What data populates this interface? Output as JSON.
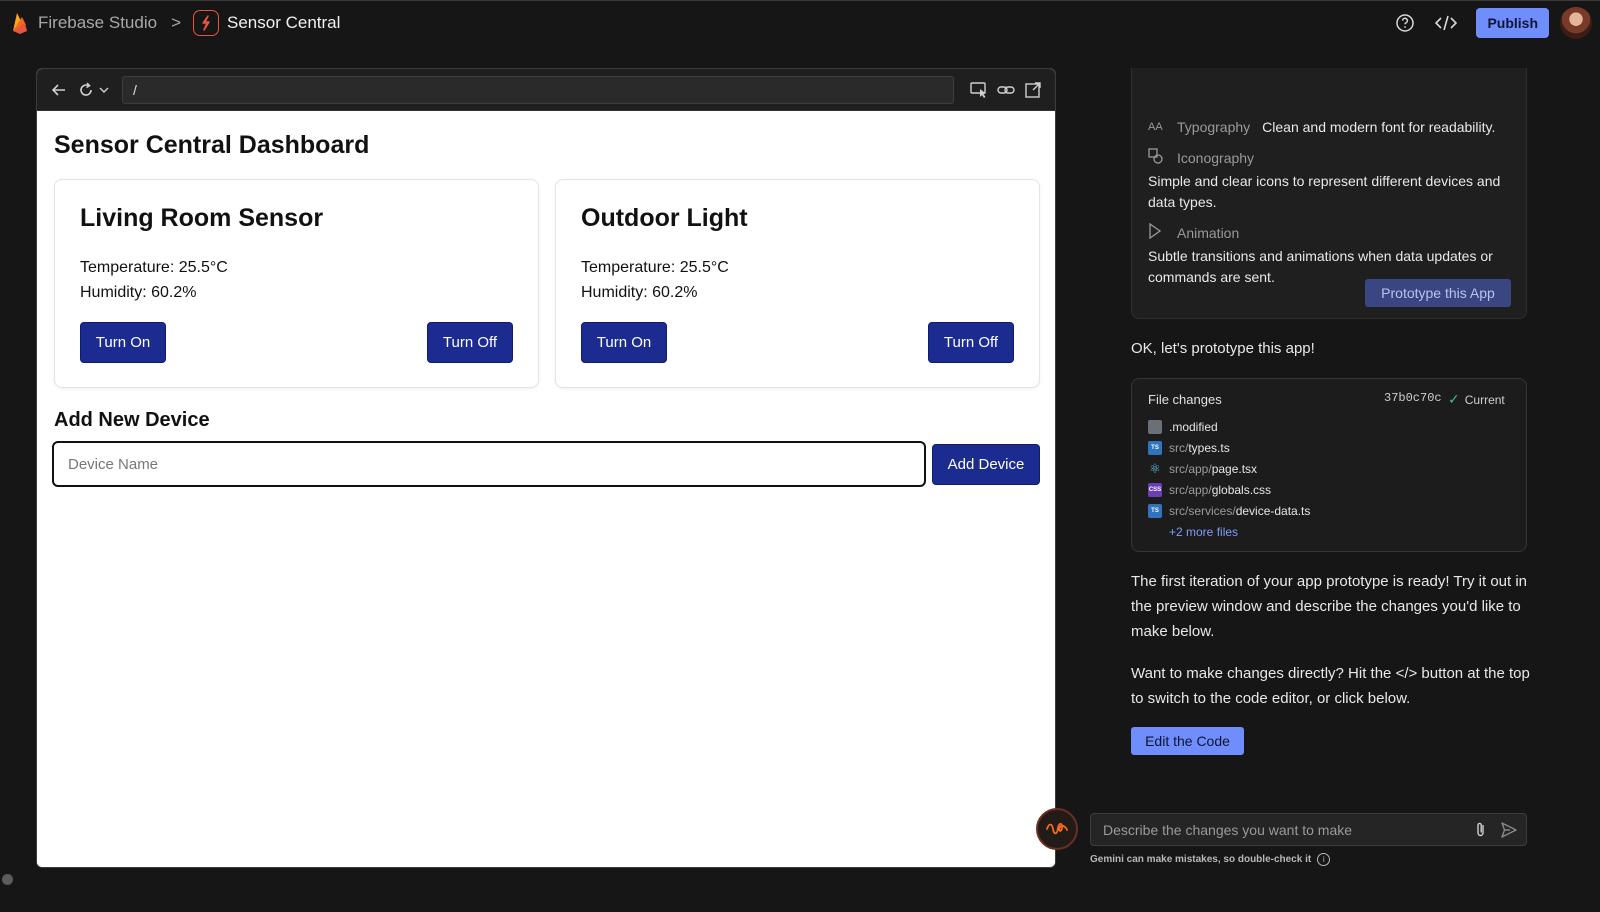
{
  "header": {
    "app_name": "Firebase Studio",
    "separator": ">",
    "project_name": "Sensor Central",
    "publish_label": "Publish"
  },
  "browser": {
    "url": "/"
  },
  "dashboard": {
    "title": "Sensor Central Dashboard",
    "devices": [
      {
        "name": "Living Room Sensor",
        "temperature": "Temperature: 25.5°C",
        "humidity": "Humidity: 60.2%",
        "on_label": "Turn On",
        "off_label": "Turn Off"
      },
      {
        "name": "Outdoor Light",
        "temperature": "Temperature: 25.5°C",
        "humidity": "Humidity: 60.2%",
        "on_label": "Turn On",
        "off_label": "Turn Off"
      }
    ],
    "add_section_title": "Add New Device",
    "device_input_placeholder": "Device Name",
    "device_input_value": "",
    "add_button_label": "Add Device"
  },
  "chat": {
    "style_guide": {
      "typography_label": "Typography",
      "typography_value": "Clean and modern font for readability.",
      "typography_icon": "AA",
      "iconography_label": "Iconography",
      "iconography_value": "Simple and clear icons to represent different devices and data types.",
      "animation_label": "Animation",
      "animation_value": "Subtle transitions and animations when data updates or commands are sent.",
      "prototype_button": "Prototype this App"
    },
    "ok_message": "OK, let's prototype this app!",
    "file_changes": {
      "title": "File changes",
      "commit": "37b0c70c",
      "status": "Current",
      "files": [
        {
          "path": "",
          "name": ".modified",
          "icon": "file-icon"
        },
        {
          "path": "src/",
          "name": "types.ts",
          "icon": "ts-icon",
          "badge": "TS"
        },
        {
          "path": "src/app/",
          "name": "page.tsx",
          "icon": "react-icon"
        },
        {
          "path": "src/app/",
          "name": "globals.css",
          "icon": "css-icon",
          "badge": "CSS"
        },
        {
          "path": "src/services/",
          "name": "device-data.ts",
          "icon": "ts-icon",
          "badge": "TS"
        }
      ],
      "more_files": "+2 more files"
    },
    "ready_message": "The first iteration of your app prototype is ready! Try it out in the preview window and describe the changes you'd like to make below.",
    "code_message": "Want to make changes directly? Hit the </> button at the top to switch to the code editor, or click below.",
    "edit_code_label": "Edit the Code",
    "prompt_placeholder": "Describe the changes you want to make",
    "prompt_value": "",
    "disclaimer": "Gemini can make mistakes, so double-check it",
    "info_glyph": "i"
  },
  "colors": {
    "accent": "#6f8dfb",
    "button_navy": "#1b2b8f",
    "firebase_orange": "#e8553b"
  }
}
